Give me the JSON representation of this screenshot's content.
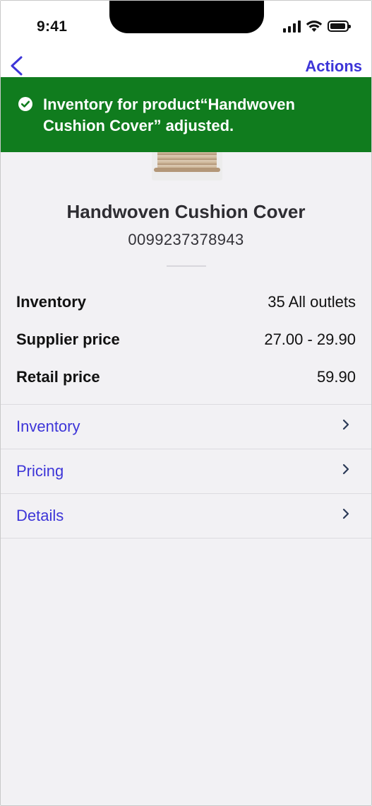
{
  "status_bar": {
    "time": "9:41"
  },
  "nav": {
    "actions_label": "Actions"
  },
  "toast": {
    "message": "Inventory for product“Handwoven Cushion Cover” adjusted.",
    "color": "#107c1e"
  },
  "product": {
    "name": "Handwoven Cushion Cover",
    "sku": "0099237378943"
  },
  "summary": {
    "inventory_label": "Inventory",
    "inventory_value": "35 All outlets",
    "supplier_price_label": "Supplier price",
    "supplier_price_value": "27.00 - 29.90",
    "retail_price_label": "Retail price",
    "retail_price_value": "59.90"
  },
  "links": [
    {
      "label": "Inventory"
    },
    {
      "label": "Pricing"
    },
    {
      "label": "Details"
    }
  ],
  "icons": {
    "back": "chevron-left-icon",
    "toast": "check-circle-icon",
    "row": "chevron-right-icon"
  },
  "colors": {
    "accent": "#3d35d8",
    "background": "#f2f1f4",
    "success": "#107c1e"
  }
}
